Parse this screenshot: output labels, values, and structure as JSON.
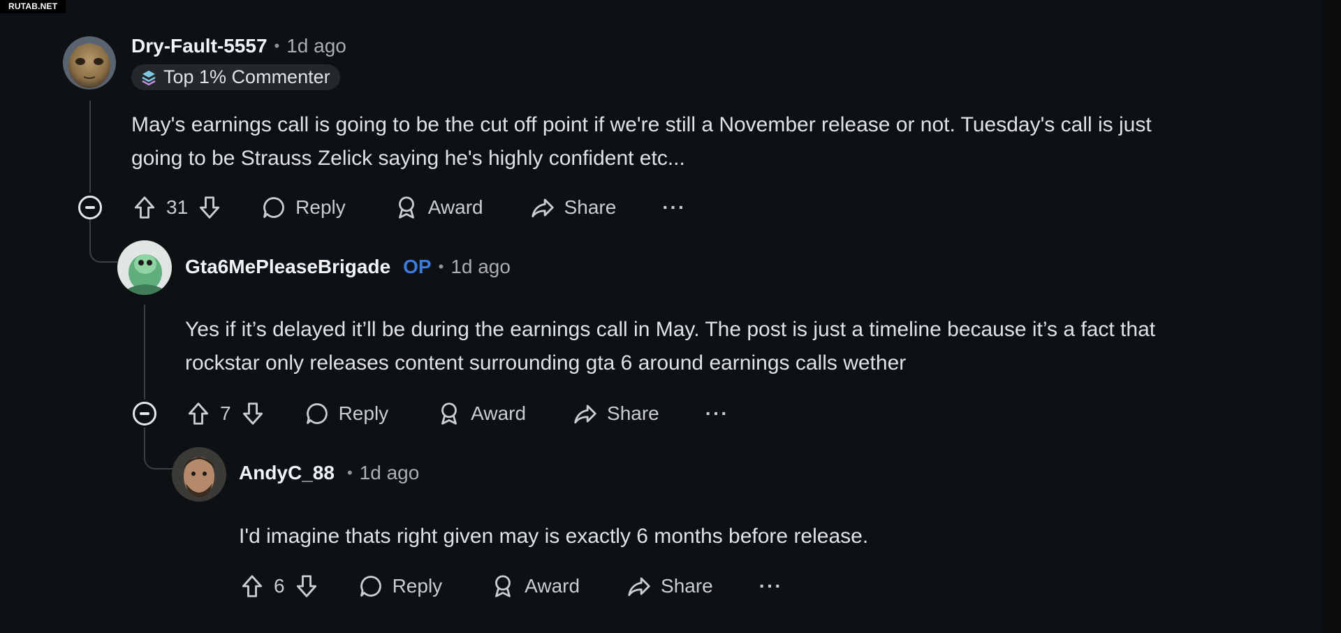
{
  "watermark": "RUTAB.NET",
  "comments": [
    {
      "username": "Dry-Fault-5557",
      "time": "1d ago",
      "badge": "Top 1% Commenter",
      "body_lines": [
        "May's earnings call is going to be the cut off point if we're still a November release or not. Tuesday's call is just",
        "going to be Strauss Zelick saying he's highly confident etc..."
      ],
      "votes": "31",
      "reply_label": "Reply",
      "award_label": "Award",
      "share_label": "Share",
      "more_label": "···"
    },
    {
      "username": "Gta6MePleaseBrigade",
      "op_label": "OP",
      "time": "1d ago",
      "body_lines": [
        "Yes if it’s delayed it’ll be during the earnings call in May. The post is just a timeline because it’s a fact that",
        "rockstar only releases content surrounding gta 6 around earnings calls wether"
      ],
      "votes": "7",
      "reply_label": "Reply",
      "award_label": "Award",
      "share_label": "Share",
      "more_label": "···"
    },
    {
      "username": "AndyC_88",
      "time": "1d ago",
      "body_lines": [
        "I'd imagine thats right given may is exactly 6 months before release."
      ],
      "votes": "6",
      "reply_label": "Reply",
      "award_label": "Award",
      "share_label": "Share",
      "more_label": "···"
    }
  ],
  "separator": "•",
  "colors": {
    "background": "#0e1113",
    "op": "#3a7be0",
    "thread_line": "#3a4043"
  },
  "icons": [
    "upvote-icon",
    "downvote-icon",
    "comment-bubble-icon",
    "award-icon",
    "share-arrow-icon",
    "collapse-minus-icon"
  ]
}
